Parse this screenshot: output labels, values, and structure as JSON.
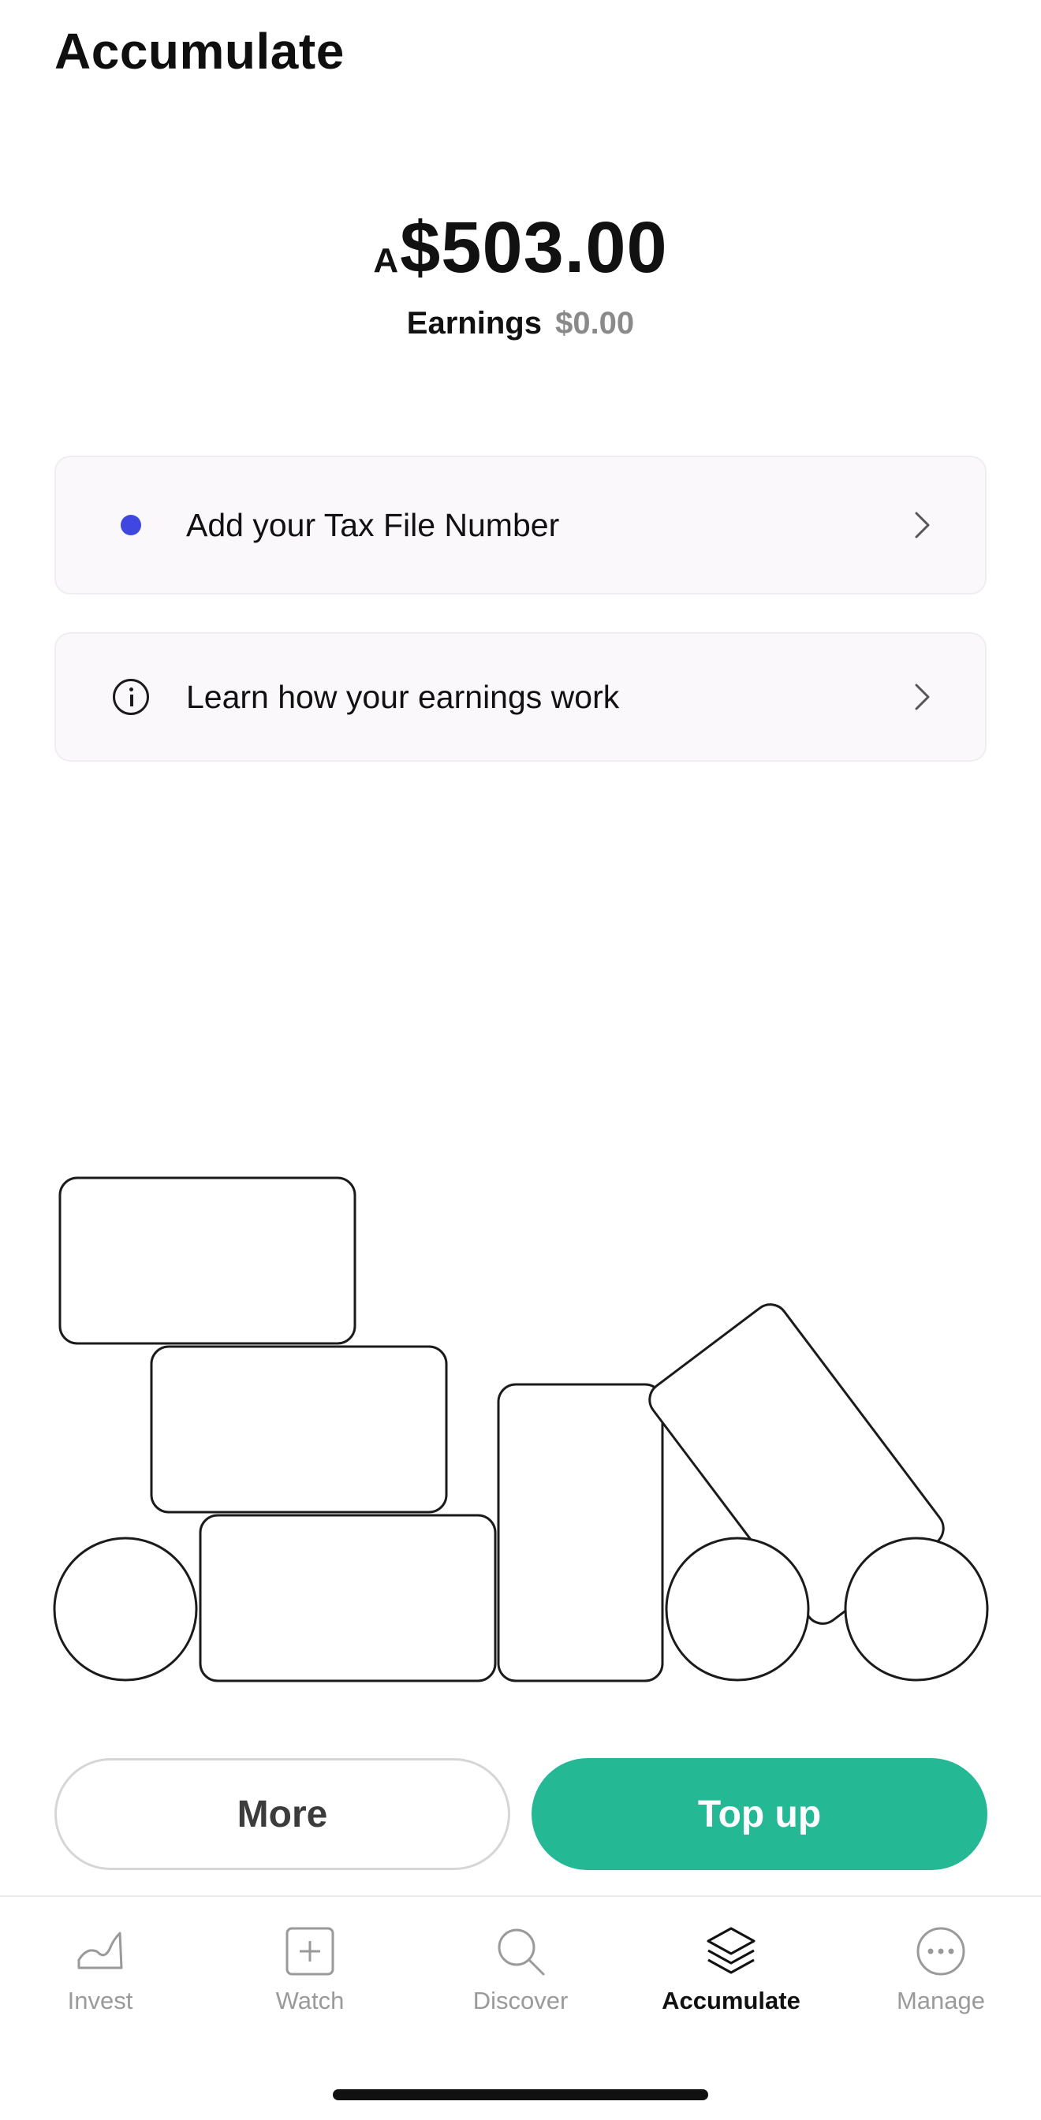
{
  "header": {
    "title": "Accumulate"
  },
  "balance": {
    "currency_prefix": "A",
    "amount": "$503.00"
  },
  "earnings": {
    "label": "Earnings",
    "value": "$0.00"
  },
  "cards": [
    {
      "label": "Add your Tax File Number",
      "lead_icon": "blue-dot",
      "trail_icon": "chevron-right-icon"
    },
    {
      "label": "Learn how your earnings work",
      "lead_icon": "info-icon",
      "trail_icon": "chevron-right-icon"
    }
  ],
  "buttons": {
    "more": "More",
    "top_up": "Top up"
  },
  "tabbar": {
    "active": "Accumulate",
    "tabs": [
      {
        "label": "Invest",
        "icon": "chart-line-icon"
      },
      {
        "label": "Watch",
        "icon": "plus-square-icon"
      },
      {
        "label": "Discover",
        "icon": "search-icon"
      },
      {
        "label": "Accumulate",
        "icon": "layers-icon"
      },
      {
        "label": "Manage",
        "icon": "more-circle-icon"
      }
    ]
  },
  "colors": {
    "accent": "#24b895",
    "dot": "#3f47e0",
    "card_bg": "#fbf8fc",
    "muted_text": "#9a9a9a"
  }
}
